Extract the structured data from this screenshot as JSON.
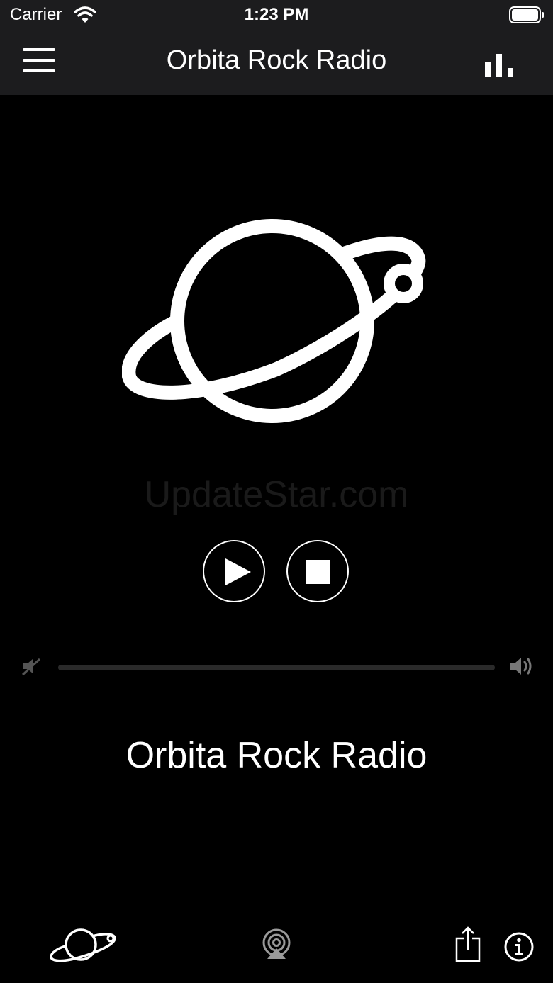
{
  "status_bar": {
    "carrier": "Carrier",
    "time": "1:23 PM",
    "wifi_icon": "wifi-icon",
    "battery_icon": "battery-icon"
  },
  "nav": {
    "title": "Orbita Rock Radio",
    "menu_icon": "hamburger-menu-icon",
    "stats_icon": "bar-chart-icon"
  },
  "player": {
    "logo_icon": "planet-logo-icon",
    "watermark": "UpdateStar.com",
    "play_icon": "play-icon",
    "stop_icon": "stop-icon",
    "volume_min_icon": "volume-mute-icon",
    "volume_max_icon": "volume-loud-icon",
    "station_name": "Orbita Rock Radio"
  },
  "toolbar": {
    "planet_icon": "planet-icon",
    "airplay_icon": "airplay-icon",
    "share_icon": "share-icon",
    "info_icon": "info-icon"
  },
  "colors": {
    "background": "#000000",
    "bar_background": "#1c1c1e",
    "foreground": "#ffffff",
    "track": "#2a2a2a",
    "watermark": "#1a1a1a"
  }
}
